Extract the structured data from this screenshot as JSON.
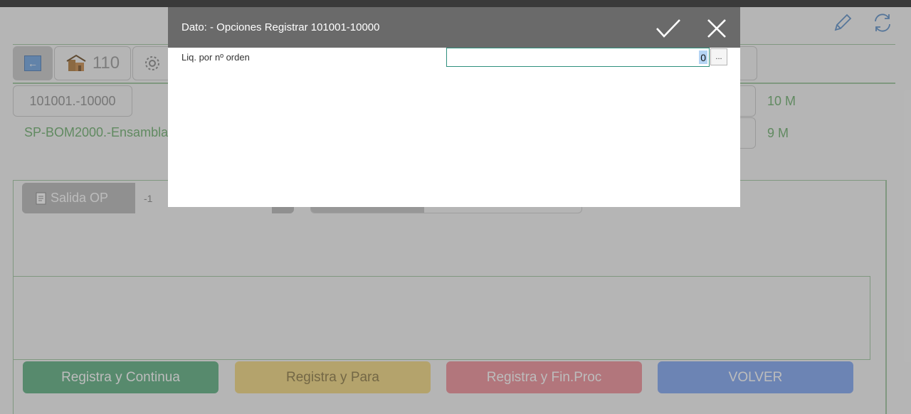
{
  "app": {
    "toolbar": {
      "code_value": "110"
    },
    "order_code": "101001.-10000",
    "order_desc": "SP-BOM2000.-Ensambla",
    "right_labels": [
      "10 M",
      "9 M"
    ],
    "salida": {
      "label": "Salida OP",
      "value": "-1"
    },
    "actions": {
      "continue": "Registra y Continua",
      "stop": "Registra y Para",
      "finish": "Registra y Fin.Proc",
      "back": "VOLVER"
    },
    "icons": {
      "edit": "pencil-icon",
      "refresh": "refresh-icon",
      "back": "back-arrow-icon",
      "code": "building-icon",
      "settings": "gear-icon"
    }
  },
  "dialog": {
    "title": "Dato: - Opciones Registrar 101001-10000",
    "field_label": "Liq. por nº orden",
    "field_value": "0",
    "ellipsis_label": "...",
    "icons": {
      "accept": "checkmark-icon",
      "close": "close-icon"
    }
  },
  "colors": {
    "accent_green": "#6cae6c",
    "dialog_header": "#6a6a6a",
    "btn_continue": "#5cae80",
    "btn_stop": "#f2d77f",
    "btn_finish": "#ef8e98",
    "btn_back": "#7fa5f2"
  }
}
